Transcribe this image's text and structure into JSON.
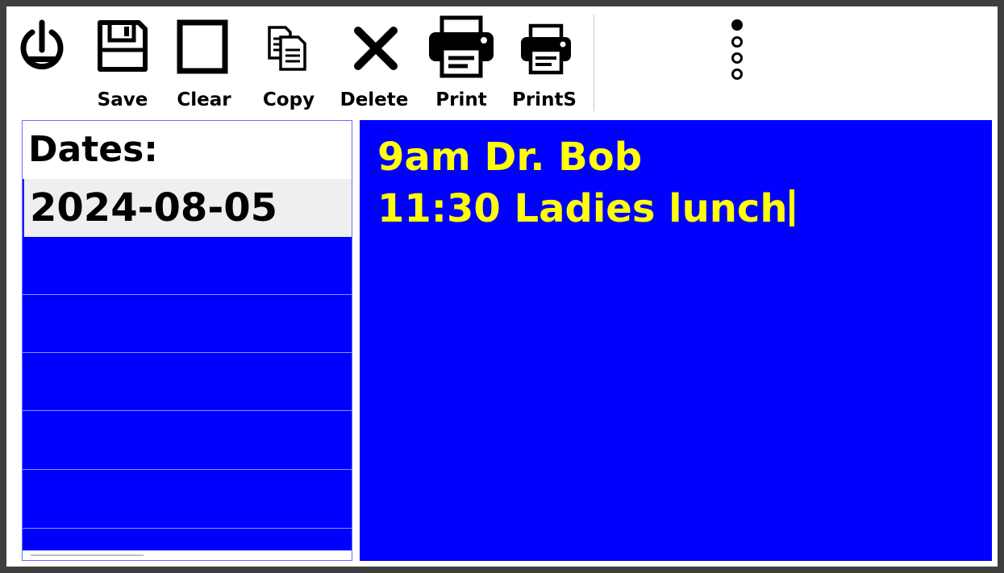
{
  "toolbar": {
    "buttons": [
      {
        "id": "power",
        "label": "",
        "icon": "power-icon"
      },
      {
        "id": "save",
        "label": "Save",
        "icon": "floppy-disk-icon"
      },
      {
        "id": "clear",
        "label": "Clear",
        "icon": "square-outline-icon"
      },
      {
        "id": "copy",
        "label": "Copy",
        "icon": "copy-documents-icon"
      },
      {
        "id": "delete",
        "label": "Delete",
        "icon": "x-close-icon"
      },
      {
        "id": "print",
        "label": "Print",
        "icon": "printer-icon"
      },
      {
        "id": "prints",
        "label": "PrintS",
        "icon": "printer-small-icon"
      }
    ],
    "menu_icon": "vertical-dots-icon"
  },
  "dates": {
    "header": "Dates:",
    "items": [
      "2024-08-05"
    ],
    "selected": "2024-08-05"
  },
  "notes": {
    "lines": [
      "9am Dr. Bob",
      "11:30 Ladies lunch"
    ]
  },
  "colors": {
    "panel_blue": "#0000ff",
    "note_text": "#ffff00",
    "frame": "#3f3f3f"
  }
}
